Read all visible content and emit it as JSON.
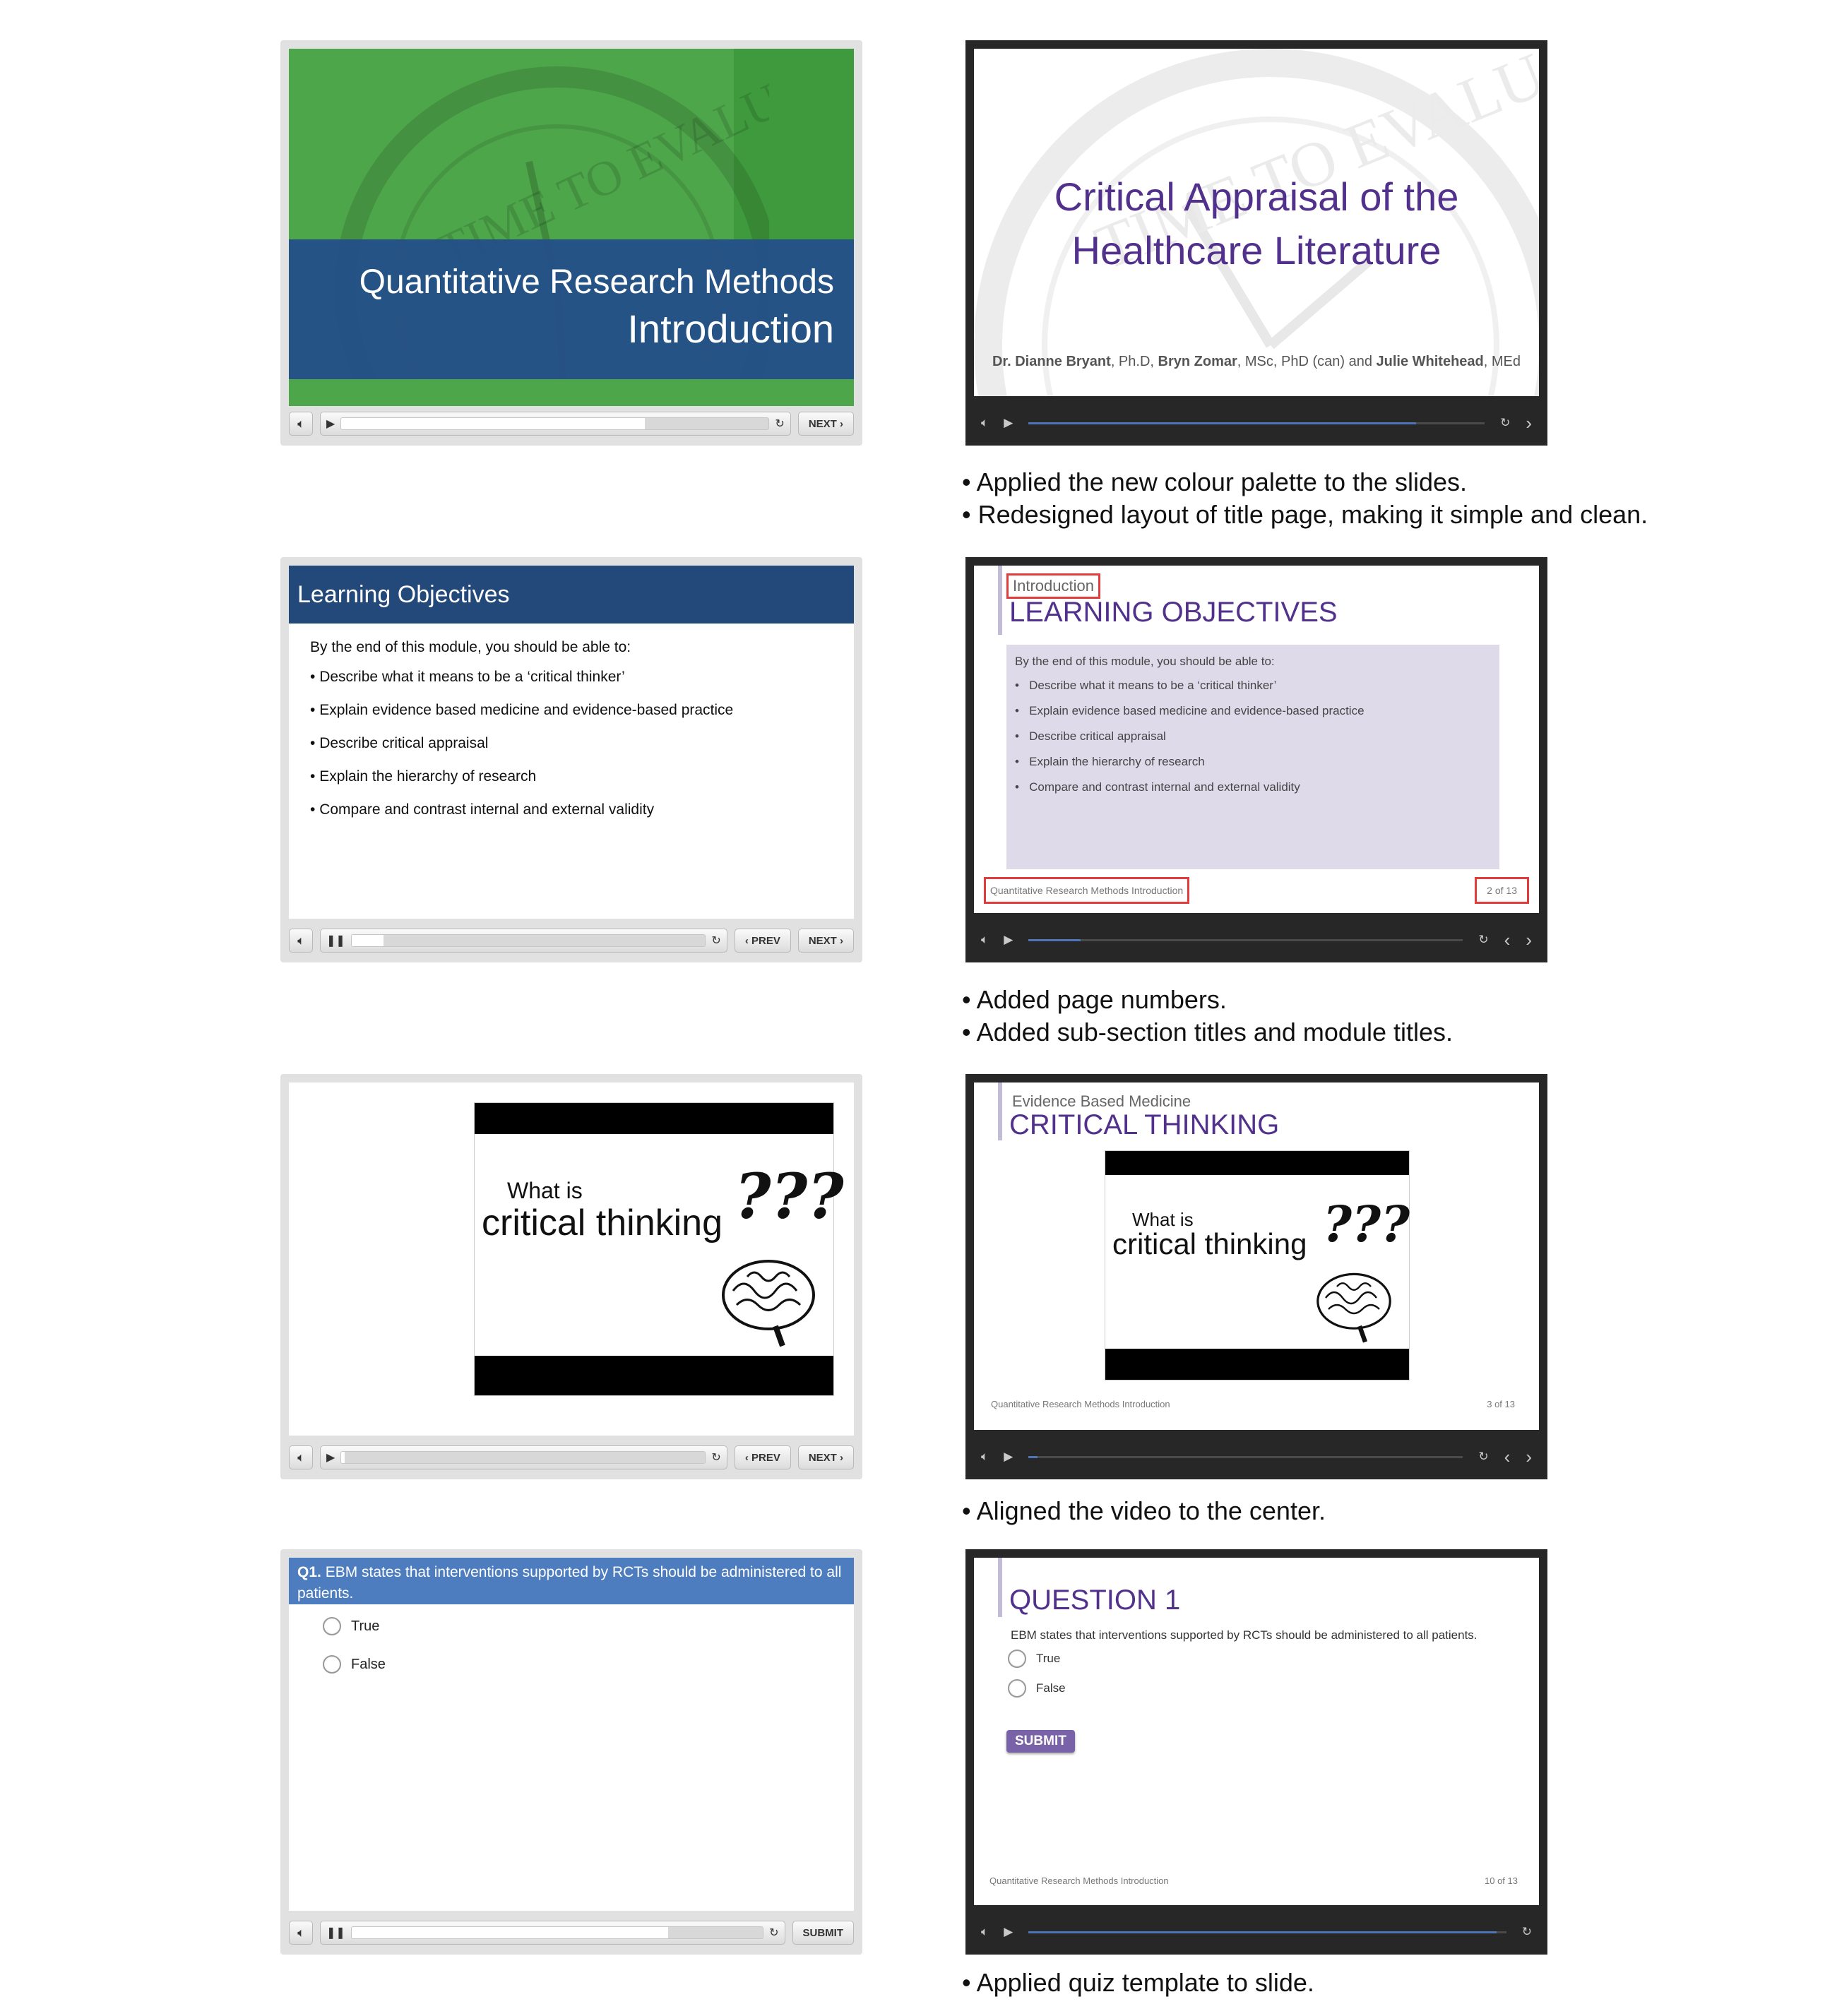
{
  "colors": {
    "old_green": "#4ea64a",
    "old_blue": "#244f87",
    "old_header_blue": "#23487a",
    "old_quiz_blue": "#4d7cbf",
    "new_dark_frame": "#272727",
    "new_purple": "#52318c",
    "new_lavender": "#dedaea",
    "highlight_red": "#e23b3b"
  },
  "controls": {
    "volume_icon": "speaker-icon",
    "play_glyph": "▶",
    "pause_glyph": "❚❚",
    "replay_glyph": "↻",
    "prev_label": "‹ PREV",
    "next_label": "NEXT ›",
    "submit_label": "SUBMIT",
    "new_prev_glyph": "‹",
    "new_next_glyph": "›"
  },
  "row1": {
    "old": {
      "title_line1": "Quantitative Research Methods",
      "title_line2": "Introduction",
      "watermark": "TIME TO EVALUATE",
      "progress": 0.71
    },
    "new": {
      "title_line1": "Critical Appraisal of the",
      "title_line2": "Healthcare Literature",
      "watermark": "TIME TO EVALUATE",
      "author1_name": "Dr. Dianne Bryant",
      "author1_cred": ", Ph.D, ",
      "author2_name": "Bryn Zomar",
      "author2_cred": ", MSc, PhD (can) and ",
      "author3_name": "Julie Whitehead",
      "author3_cred": ", MEd",
      "progress": 0.85
    },
    "captions": [
      "• Applied the new colour palette to the slides.",
      "• Redesigned layout of title page, making it simple and clean."
    ]
  },
  "row2": {
    "old": {
      "header": "Learning Objectives",
      "intro": "By the end of this module, you should be able to:",
      "bullets": [
        "Describe what it means to be a ‘critical thinker’",
        "Explain evidence based medicine and evidence-based practice",
        "Describe critical appraisal",
        "Explain the hierarchy of research",
        "Compare and contrast internal and external validity"
      ],
      "progress": 0.09
    },
    "new": {
      "section": "Introduction",
      "title": "LEARNING OBJECTIVES",
      "intro": "By the end of this module, you should be able to:",
      "bullets": [
        "Describe what it means to be a ‘critical thinker’",
        "Explain evidence based medicine and evidence-based practice",
        "Describe critical appraisal",
        "Explain the hierarchy of research",
        "Compare and contrast internal and external validity"
      ],
      "footer_module": "Quantitative Research Methods Introduction",
      "footer_page": "2 of 13",
      "progress": 0.12
    },
    "captions": [
      "• Added page numbers.",
      "• Added sub-section titles and module titles."
    ]
  },
  "row3": {
    "old": {
      "video_line1": "What is",
      "video_line2": "critical thinking",
      "video_marks": "???",
      "brain_icon": "brain-icon",
      "progress": 0.01
    },
    "new": {
      "section": "Evidence Based Medicine",
      "title": "CRITICAL THINKING",
      "video_line1": "What is",
      "video_line2": "critical thinking",
      "video_marks": "???",
      "brain_icon": "brain-icon",
      "footer_module": "Quantitative Research Methods Introduction",
      "footer_page": "3 of 13",
      "progress": 0.02
    },
    "captions": [
      "• Aligned the video to the center."
    ]
  },
  "row4": {
    "old": {
      "q_label": "Q1.",
      "q_text": " EBM states that interventions supported by RCTs should be administered to all patients.",
      "options": [
        "True",
        "False"
      ],
      "progress": 0.77
    },
    "new": {
      "title": "QUESTION 1",
      "q_text": "EBM states that interventions supported by RCTs should be administered to all patients.",
      "options": [
        "True",
        "False"
      ],
      "submit": "SUBMIT",
      "footer_module": "Quantitative Research Methods Introduction",
      "footer_page": "10 of 13",
      "progress": 0.98
    },
    "captions": [
      "• Applied quiz template to slide."
    ]
  }
}
